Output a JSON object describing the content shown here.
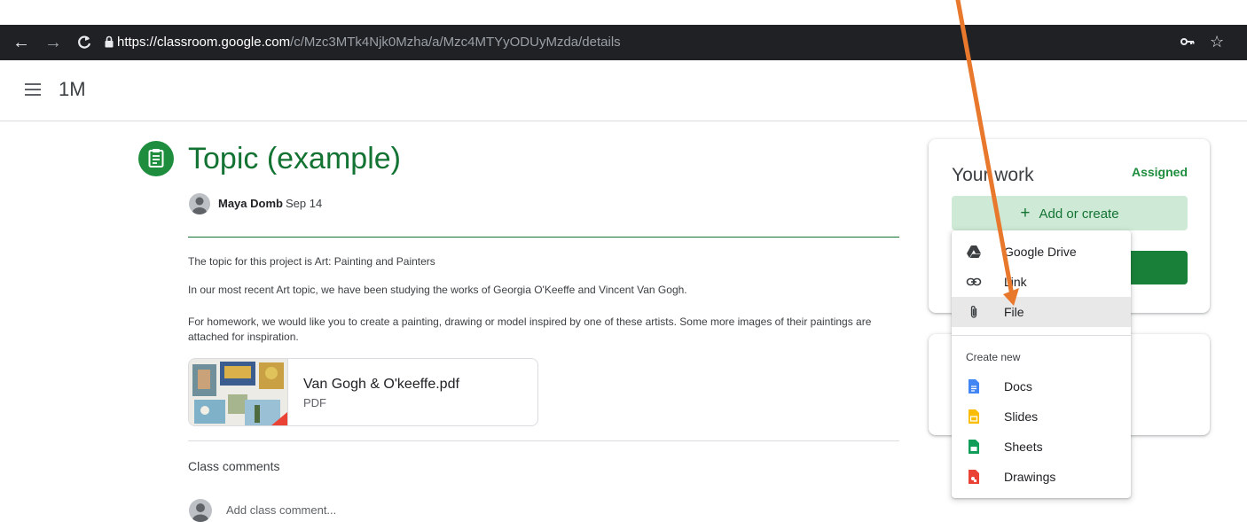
{
  "browser": {
    "url_host": "https://classroom.google.com",
    "url_path": "/c/Mzc3MTk4Njk0Mzha/a/Mzc4MTYyODUyMzda/details",
    "back_icon": "arrow-left-icon",
    "forward_icon": "arrow-right-icon",
    "reload_icon": "reload-icon",
    "key_icon": "key-icon",
    "star_icon": "star-icon"
  },
  "header": {
    "class_name": "1M",
    "menu_icon": "hamburger-icon"
  },
  "assignment": {
    "title": "Topic (example)",
    "author": "Maya Domb",
    "date": "Sep 14",
    "paragraphs": [
      "The topic for this project is Art: Painting and Painters",
      "In our most recent Art topic, we have been studying the works of Georgia O'Keeffe and Vincent Van Gogh.",
      "For homework, we would like you to create a painting, drawing or model inspired by one of these artists. Some more images of their paintings are attached for inspiration."
    ],
    "attachment": {
      "name": "Van Gogh & O'keeffe.pdf",
      "type": "PDF"
    }
  },
  "comments": {
    "heading": "Class comments",
    "placeholder": "Add class comment..."
  },
  "your_work": {
    "title": "Your work",
    "status": "Assigned",
    "add_label": "Add or create",
    "status_color": "#1e8e3e"
  },
  "menu": {
    "items": [
      {
        "label": "Google Drive",
        "icon": "google-drive-icon"
      },
      {
        "label": "Link",
        "icon": "link-icon"
      },
      {
        "label": "File",
        "icon": "paperclip-icon"
      }
    ],
    "section_label": "Create new",
    "create_items": [
      {
        "label": "Docs",
        "icon": "docs-icon",
        "color": "#4285f4"
      },
      {
        "label": "Slides",
        "icon": "slides-icon",
        "color": "#fbbc04"
      },
      {
        "label": "Sheets",
        "icon": "sheets-icon",
        "color": "#0f9d58"
      },
      {
        "label": "Drawings",
        "icon": "drawings-icon",
        "color": "#ea4335"
      }
    ]
  },
  "colors": {
    "accent_green": "#137333",
    "annotation_arrow": "#e8782c"
  }
}
